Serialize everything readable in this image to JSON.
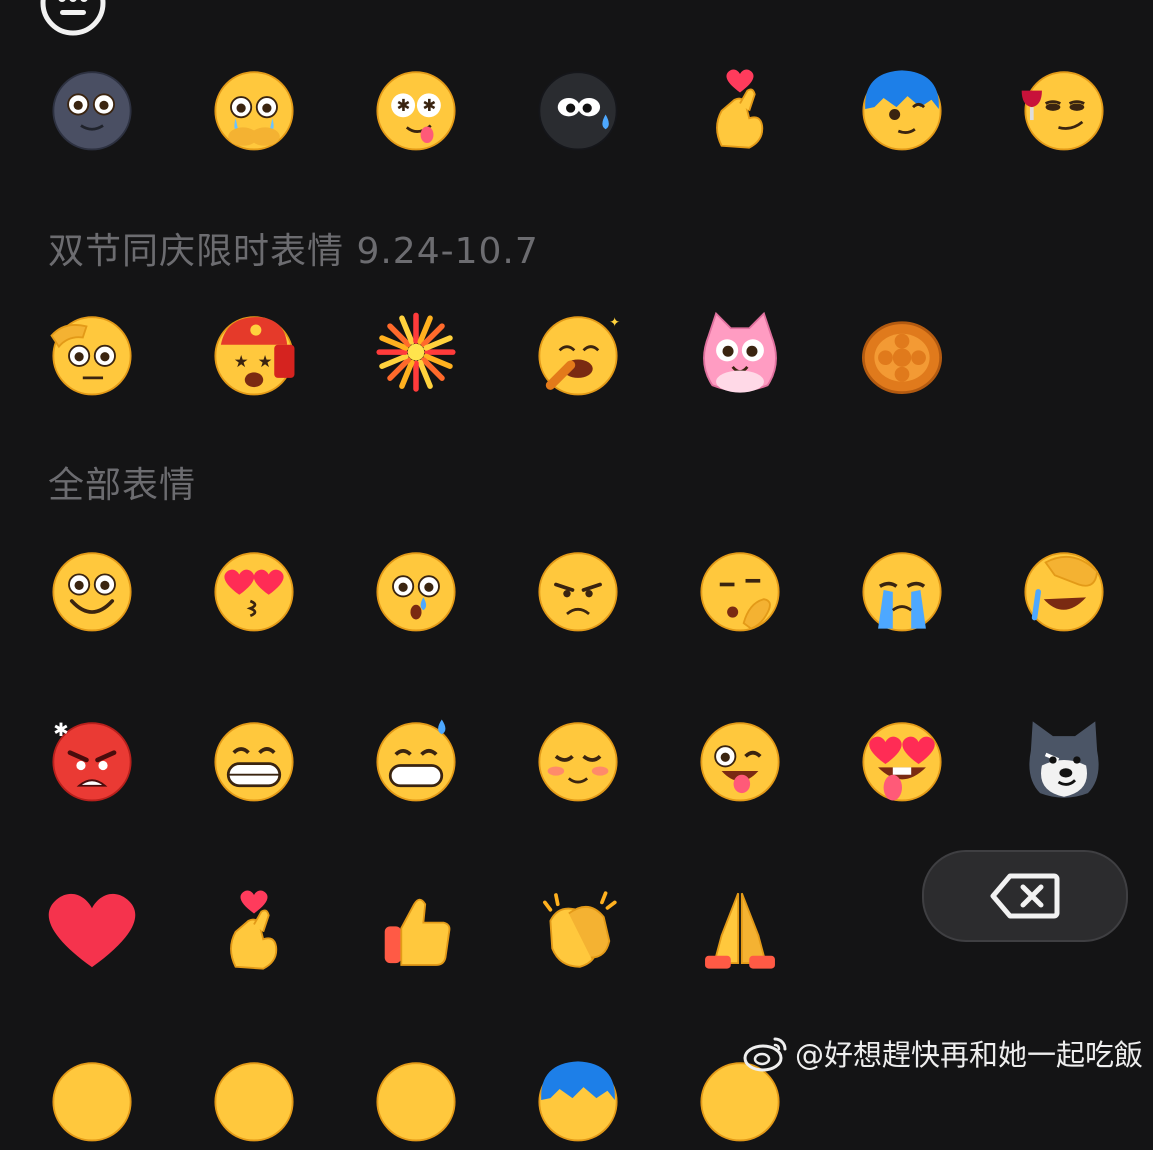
{
  "sections": [
    {
      "id": "limited",
      "title": "双节同庆限时表情 9.24-10.7"
    },
    {
      "id": "all",
      "title": "全部表情"
    }
  ],
  "emoji_rows": [
    [
      "dark-moon-face",
      "crying-grateful-face",
      "dizzy-star-eyes-face",
      "black-blob-sweat",
      "finger-heart-hand",
      "blue-hair-face",
      "wine-smug-face"
    ],
    [
      "salute-face",
      "red-envelope-mascot",
      "fireworks",
      "eating-yummy-face",
      "pink-cat-mascot",
      "mooncake"
    ],
    [
      "smiling-face",
      "heart-eyes-kiss-face",
      "shocked-sweat-face",
      "annoyed-face",
      "thinking-face",
      "loudly-crying-face",
      "facepalm-laughing-face"
    ],
    [
      "angry-face",
      "big-grin-face",
      "grin-sweat-face",
      "blushing-content-face",
      "winking-tongue-face",
      "heart-eyes-tongue-face",
      "husky-dog-face"
    ],
    [
      "red-heart",
      "finger-heart-hand",
      "thumbs-up",
      "clapping-hands",
      "folded-hands"
    ],
    [
      "cowboy-face-partial",
      "face-partial",
      "star-face-partial",
      "blue-hair-partial",
      "face-partial-2"
    ]
  ],
  "controls": {
    "top_icon": "emoji-keyboard-icon",
    "delete_icon": "backspace-icon"
  },
  "watermark": {
    "text": "@好想趕快再和她一起吃飯",
    "icon": "weibo-icon"
  },
  "colors": {
    "background": "#141415",
    "section_title": "#6c6c70",
    "key_bg": "#2c2c2e"
  }
}
